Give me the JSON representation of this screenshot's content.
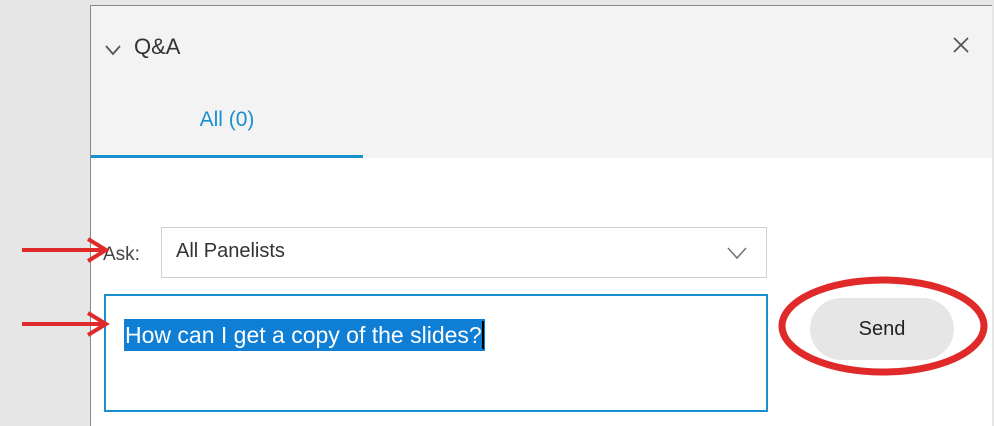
{
  "panel": {
    "title": "Q&A",
    "tabs": [
      {
        "label": "All (0)"
      }
    ]
  },
  "ask": {
    "label": "Ask:",
    "selected": "All Panelists"
  },
  "question": {
    "text": "How can I get a copy of the slides?"
  },
  "actions": {
    "send_label": "Send"
  },
  "colors": {
    "accent": "#1a8fcf",
    "selection": "#0f7fd6",
    "annotation": "#e02a2a",
    "header_bg": "#f3f3f3"
  },
  "icons": [
    "chevron-down-icon",
    "close-icon",
    "red-arrow",
    "red-circle"
  ]
}
